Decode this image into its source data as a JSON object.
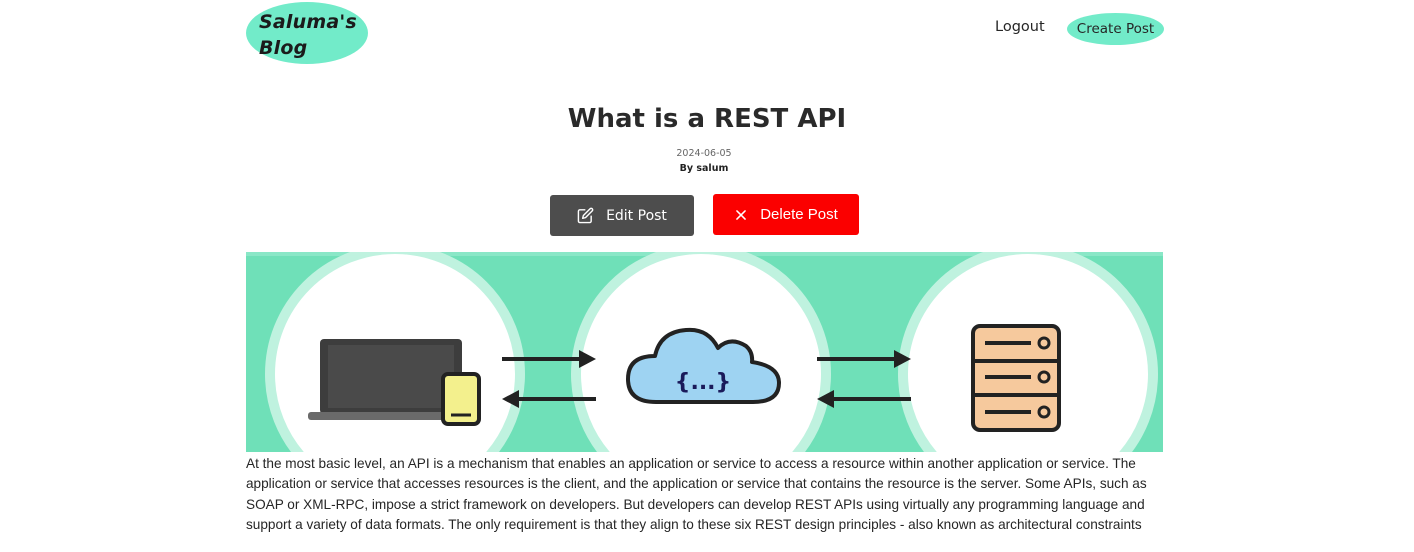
{
  "header": {
    "logo_line1": "Saluma's",
    "logo_line2": "Blog",
    "logout_label": "Logout",
    "create_post_label": "Create Post",
    "accent_color": "#72ebc9"
  },
  "post": {
    "title": "What is a REST API",
    "date": "2024-06-05",
    "author": "By salum",
    "edit_label": "Edit Post",
    "delete_label": "Delete Post",
    "edit_icon": "edit-icon",
    "delete_icon": "close-icon",
    "image_icons": [
      "laptop-icon",
      "phone-icon",
      "cloud-icon",
      "server-icon",
      "arrow-right-icon",
      "arrow-left-icon"
    ],
    "image_cloud_text": "{...}",
    "body": "At the most basic level, an API is a mechanism that enables an application or service to access a resource within another application or service. The application or service that accesses resources is the client, and the application or service that contains the resource is the server. Some APIs, such as SOAP or XML-RPC, impose a strict framework on developers. But developers can develop REST APIs using virtually any programming language and support a variety of data formats. The only requirement is that they align to these six REST design principles - also known as architectural constraints"
  }
}
